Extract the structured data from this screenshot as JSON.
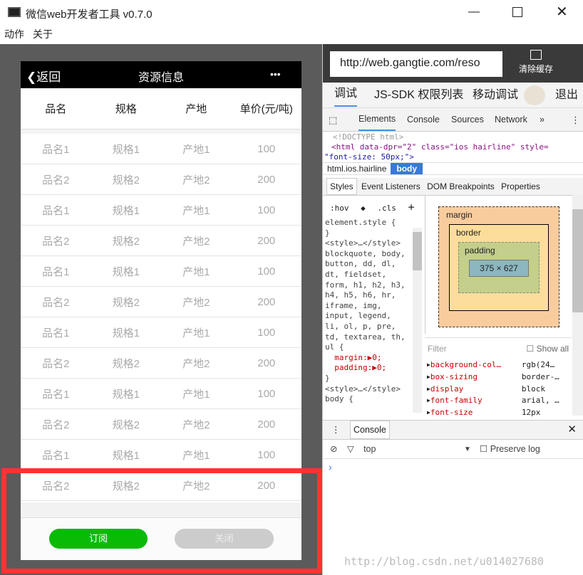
{
  "window": {
    "title": "微信web开发者工具 v0.7.0",
    "menu": [
      "动作",
      "关于"
    ]
  },
  "phone": {
    "back_label": "返回",
    "title": "资源信息",
    "more": "•••",
    "columns": [
      "品名",
      "规格",
      "产地",
      "单价(元/吨)"
    ],
    "rows": [
      [
        "品名1",
        "规格1",
        "产地1",
        "100"
      ],
      [
        "品名2",
        "规格2",
        "产地2",
        "200"
      ],
      [
        "品名1",
        "规格1",
        "产地1",
        "100"
      ],
      [
        "品名2",
        "规格2",
        "产地2",
        "200"
      ],
      [
        "品名1",
        "规格1",
        "产地1",
        "100"
      ],
      [
        "品名2",
        "规格2",
        "产地2",
        "200"
      ],
      [
        "品名1",
        "规格1",
        "产地1",
        "100"
      ],
      [
        "品名2",
        "规格2",
        "产地2",
        "200"
      ],
      [
        "品名1",
        "规格1",
        "产地1",
        "100"
      ],
      [
        "品名2",
        "规格2",
        "产地2",
        "200"
      ],
      [
        "品名1",
        "规格1",
        "产地1",
        "100"
      ],
      [
        "品名2",
        "规格2",
        "产地2",
        "200"
      ]
    ],
    "subscribe_label": "订阅",
    "close_label": "关闭",
    "accent": "#09bb07"
  },
  "devtools": {
    "url": "http://web.gangtie.com/reso",
    "clear_cache": "清除缓存",
    "top_tabs": [
      "调试",
      "JS-SDK 权限列表",
      "移动调试"
    ],
    "logout": "退出",
    "tabs": [
      "Elements",
      "Console",
      "Sources",
      "Network",
      "»"
    ],
    "dom": [
      "<!DOCTYPE html>",
      "<html data-dpr=\"2\" class=\"ios hairline\" style=",
      "\"font-size: 50px;\">"
    ],
    "breadcrumb": [
      "html.ios.hairline",
      "body"
    ],
    "style_tabs": [
      "Styles",
      "Event Listeners",
      "DOM Breakpoints",
      "Properties"
    ],
    "hov": ":hov",
    "cls": ".cls",
    "plus": "+",
    "styles_text": [
      "element.style {",
      "}",
      "<style>…</style>",
      "blockquote, body,",
      "button, dd, dl,",
      "dt, fieldset,",
      "form, h1, h2, h3,",
      "h4, h5, h6, hr,",
      "iframe, img,",
      "input, legend,",
      "li, ol, p, pre,",
      "td, textarea, th,",
      "ul {",
      "  margin:▶0;",
      "  padding:▶0;",
      "}",
      "<style>…</style>",
      "body {"
    ],
    "box": {
      "margin": "margin",
      "border": "border",
      "padding": "padding",
      "dash": "–",
      "content": "375 × 627"
    },
    "filter_placeholder": "Filter",
    "show_all": "Show all",
    "computed": [
      [
        "background-col…",
        "rgb(24…"
      ],
      [
        "box-sizing",
        "border-…"
      ],
      [
        "display",
        "block"
      ],
      [
        "font-family",
        "arial, …"
      ],
      [
        "font-size",
        "12px"
      ]
    ],
    "console_tab": "Console",
    "context": "top",
    "preserve_log": "Preserve log",
    "prompt": "›"
  },
  "watermark": "http://blog.csdn.net/u014027680"
}
